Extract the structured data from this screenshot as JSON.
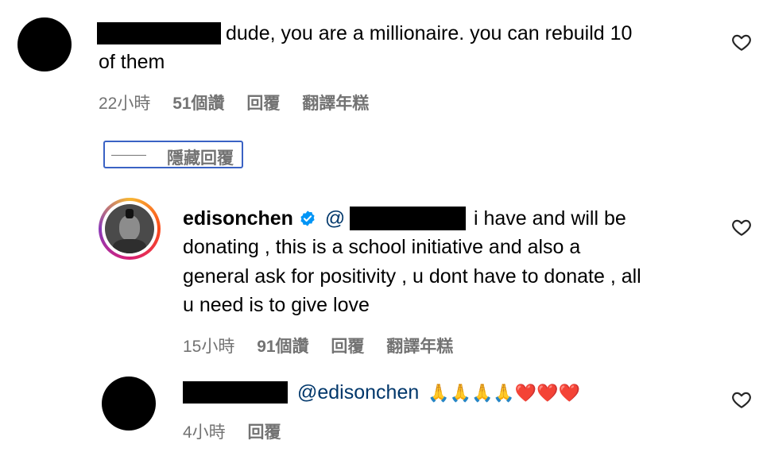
{
  "comments": [
    {
      "text": "dude, you are a millionaire. you can rebuild 10 of them",
      "text_line1": "dude, you are a millionaire. you can rebuild 10",
      "text_line2": "of them",
      "time": "22小時",
      "likes": "51個讚",
      "reply": "回覆",
      "translate": "翻譯年糕"
    }
  ],
  "hide_replies_label": "隱藏回覆",
  "replies": [
    {
      "username": "edisonchen",
      "mention_prefix": "@",
      "line1": "i have and will be",
      "line2": "donating , this is a school initiative and also a",
      "line3": "general ask for positivity , u dont have to donate , all",
      "line4": "u need is to give love",
      "time": "15小時",
      "likes": "91個讚",
      "reply": "回覆",
      "translate": "翻譯年糕"
    },
    {
      "mention": "@edisonchen",
      "emojis": "🙏🙏🙏🙏❤️❤️❤️",
      "time": "4小時",
      "reply": "回覆"
    }
  ],
  "colors": {
    "mention": "#00376b",
    "meta": "#737373",
    "hide_border": "#3a62c4",
    "verified": "#0095f6"
  }
}
